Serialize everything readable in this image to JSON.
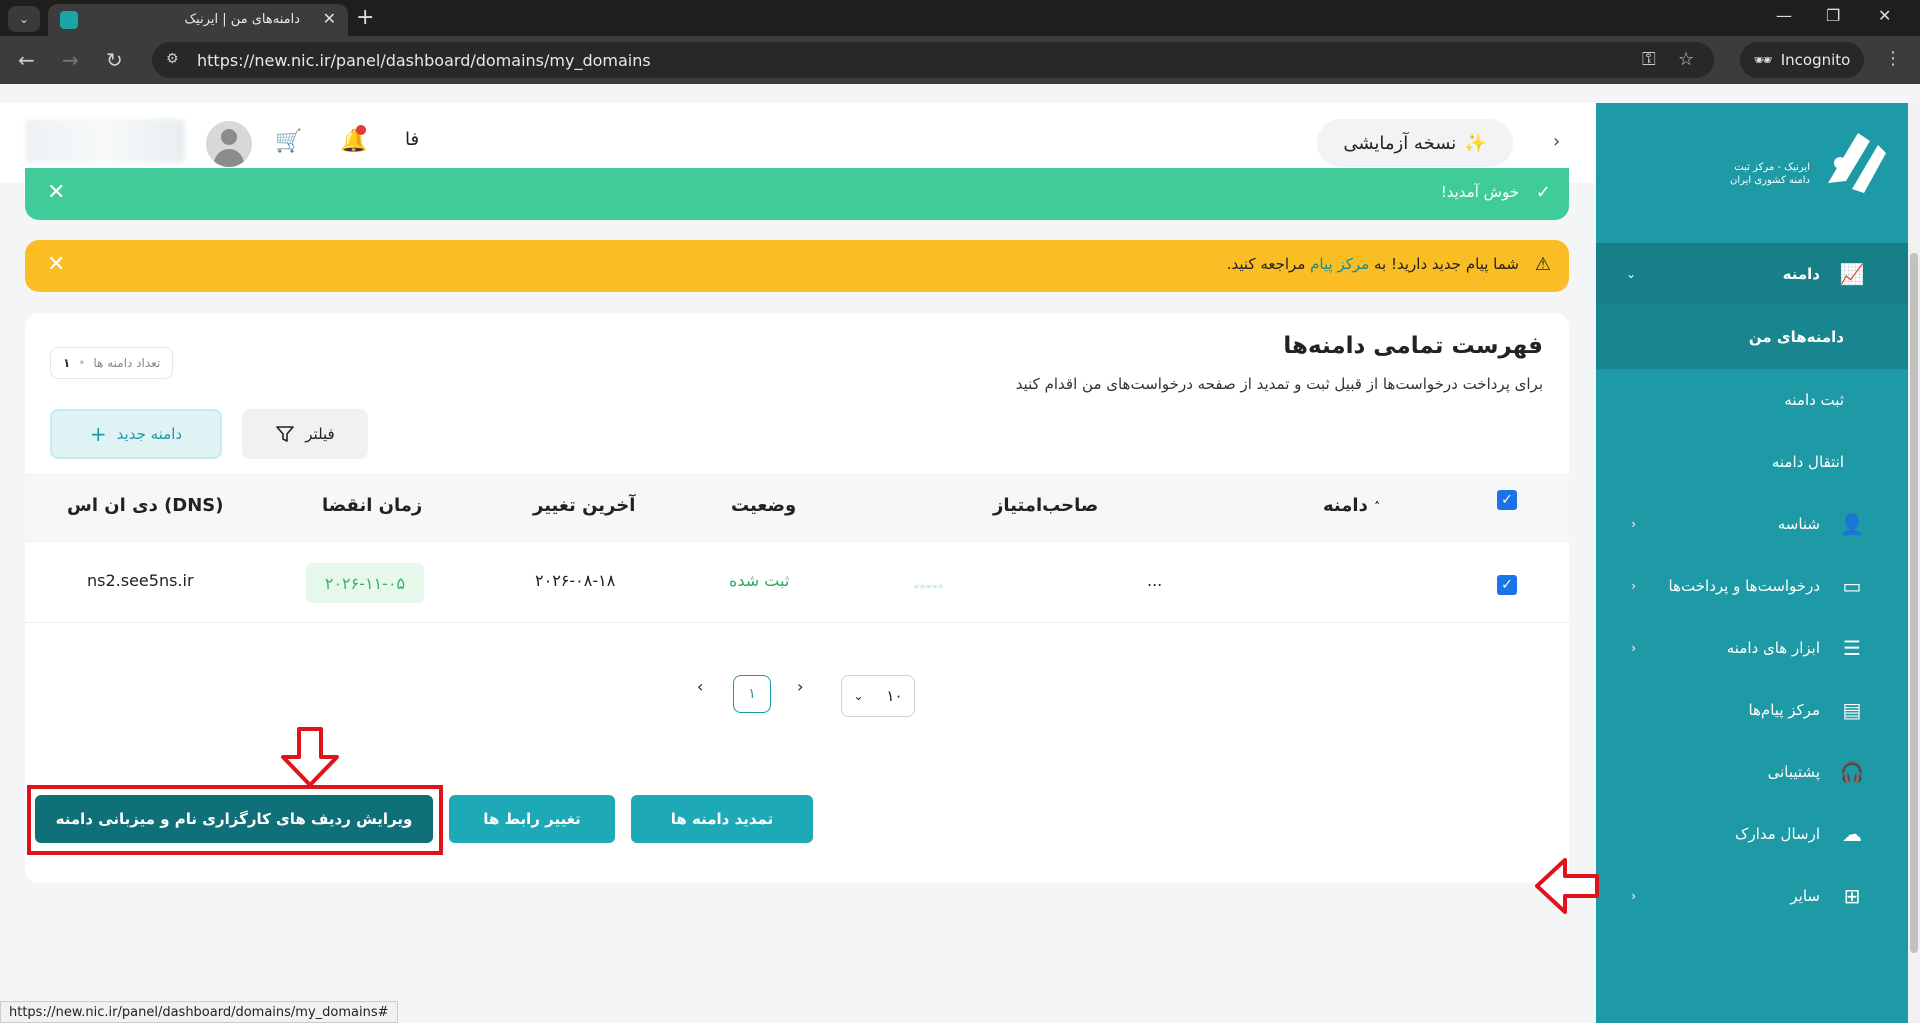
{
  "browser": {
    "tab_title": "دامنه‌های من | ایرنیک",
    "url": "https://new.nic.ir/panel/dashboard/domains/my_domains",
    "incognito_label": "Incognito",
    "status_url": "https://new.nic.ir/panel/dashboard/domains/my_domains#"
  },
  "header": {
    "beta_label": "نسخه آزمایشی",
    "lang": "فا"
  },
  "sidebar": {
    "logo_text_line1": "ایرنیک - مرکز ثبت",
    "logo_text_line2": "دامنه کشوری ایران",
    "domain_section": "دامنه",
    "sub_items": [
      "دامنه‌های من",
      "ثبت دامنه",
      "انتقال دامنه"
    ],
    "items": [
      {
        "label": "شناسه",
        "icon": "user-icon"
      },
      {
        "label": "درخواست‌ها و پرداخت‌ها",
        "icon": "card-icon"
      },
      {
        "label": "ابزار های دامنه",
        "icon": "sliders-icon"
      },
      {
        "label": "مرکز پیام‌ها",
        "icon": "message-icon"
      },
      {
        "label": "پشتیبانی",
        "icon": "headset-icon"
      },
      {
        "label": "ارسال مدارک",
        "icon": "cloud-upload-icon"
      },
      {
        "label": "سایر",
        "icon": "grid-icon"
      }
    ]
  },
  "alerts": {
    "welcome": "خوش آمدید!",
    "message_prefix": "شما پیام جدید دارید! به",
    "message_link": "مرکز پیام",
    "message_suffix": "مراجعه کنید."
  },
  "card": {
    "title": "فهرست تمامی دامنه‌ها",
    "description": "برای پرداخت درخواست‌ها از قبیل ثبت و تمدید از صفحه درخواست‌های من اقدام کنید",
    "count_label": "تعداد دامنه ها",
    "count_value": "۱",
    "new_domain_button": "دامنه جدید",
    "filter_button": "فیلتر"
  },
  "table": {
    "headers": {
      "domain": "دامنه",
      "owner": "صاحب‌امتیاز",
      "status": "وضعیت",
      "last_change": "آخرین تغییر",
      "expire": "زمان انقضا",
      "dns": "دی ان اس (DNS)"
    },
    "rows": [
      {
        "domain": "...",
        "owner": "ـ ـ ـ ـ ـ",
        "status": "ثبت شده",
        "last_change": "۲۰۲۶-۰۸-۱۸",
        "expire": "۲۰۲۶-۱۱-۰۵",
        "dns": "ns2.see5ns.ir"
      }
    ]
  },
  "pagination": {
    "current_page": "۱",
    "page_size": "۱۰"
  },
  "actions": {
    "renew": "تمدید دامنه ها",
    "change_contacts": "تغییر رابط ها",
    "edit_ns": "ویرایش ردیف های کارگزاری نام و میزبانی دامنه"
  },
  "colors": {
    "brand": "#1d9aa5",
    "sidebar": "#1d9aa5",
    "success": "#3fcc98",
    "warning": "#fbbd24",
    "annotation": "#e0121a"
  }
}
